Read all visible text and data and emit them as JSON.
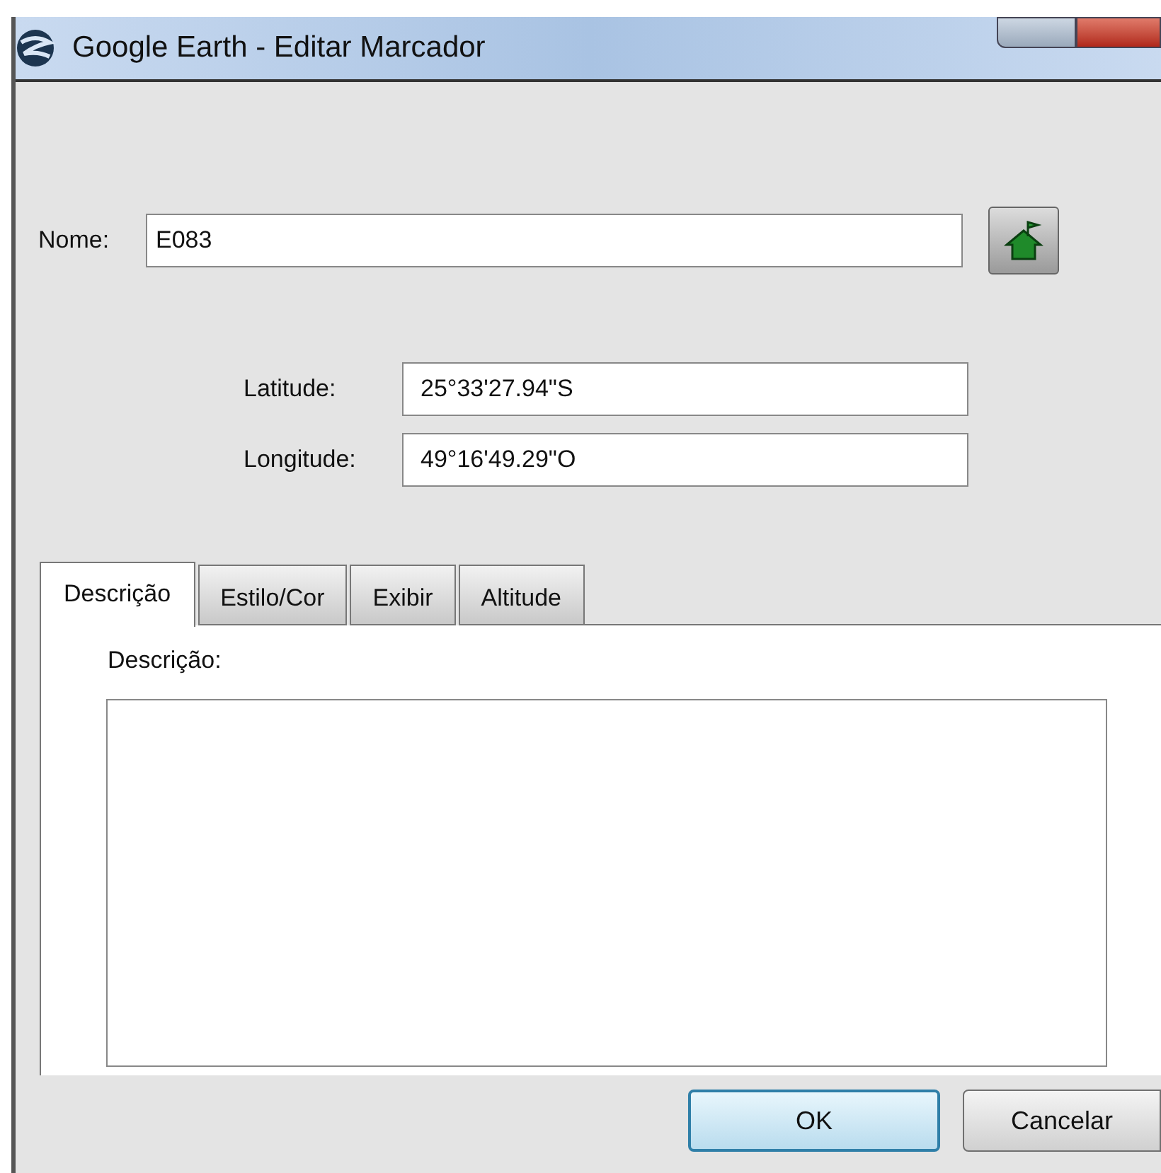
{
  "window": {
    "title": "Google Earth - Editar Marcador"
  },
  "name": {
    "label": "Nome:",
    "value": "E083"
  },
  "coordinates": [
    {
      "label": "Latitude:",
      "value": "25°33'27.94\"S"
    },
    {
      "label": "Longitude:",
      "value": "49°16'49.29\"O"
    }
  ],
  "tabs": [
    {
      "label": "Descrição",
      "selected": true
    },
    {
      "label": "Estilo/Cor",
      "selected": false
    },
    {
      "label": "Exibir",
      "selected": false
    },
    {
      "label": "Altitude",
      "selected": false
    }
  ],
  "description": {
    "label": "Descrição:"
  },
  "buttons": [
    {
      "label": "OK",
      "kind": "default"
    },
    {
      "label": "Cancelar",
      "kind": "normal"
    }
  ]
}
